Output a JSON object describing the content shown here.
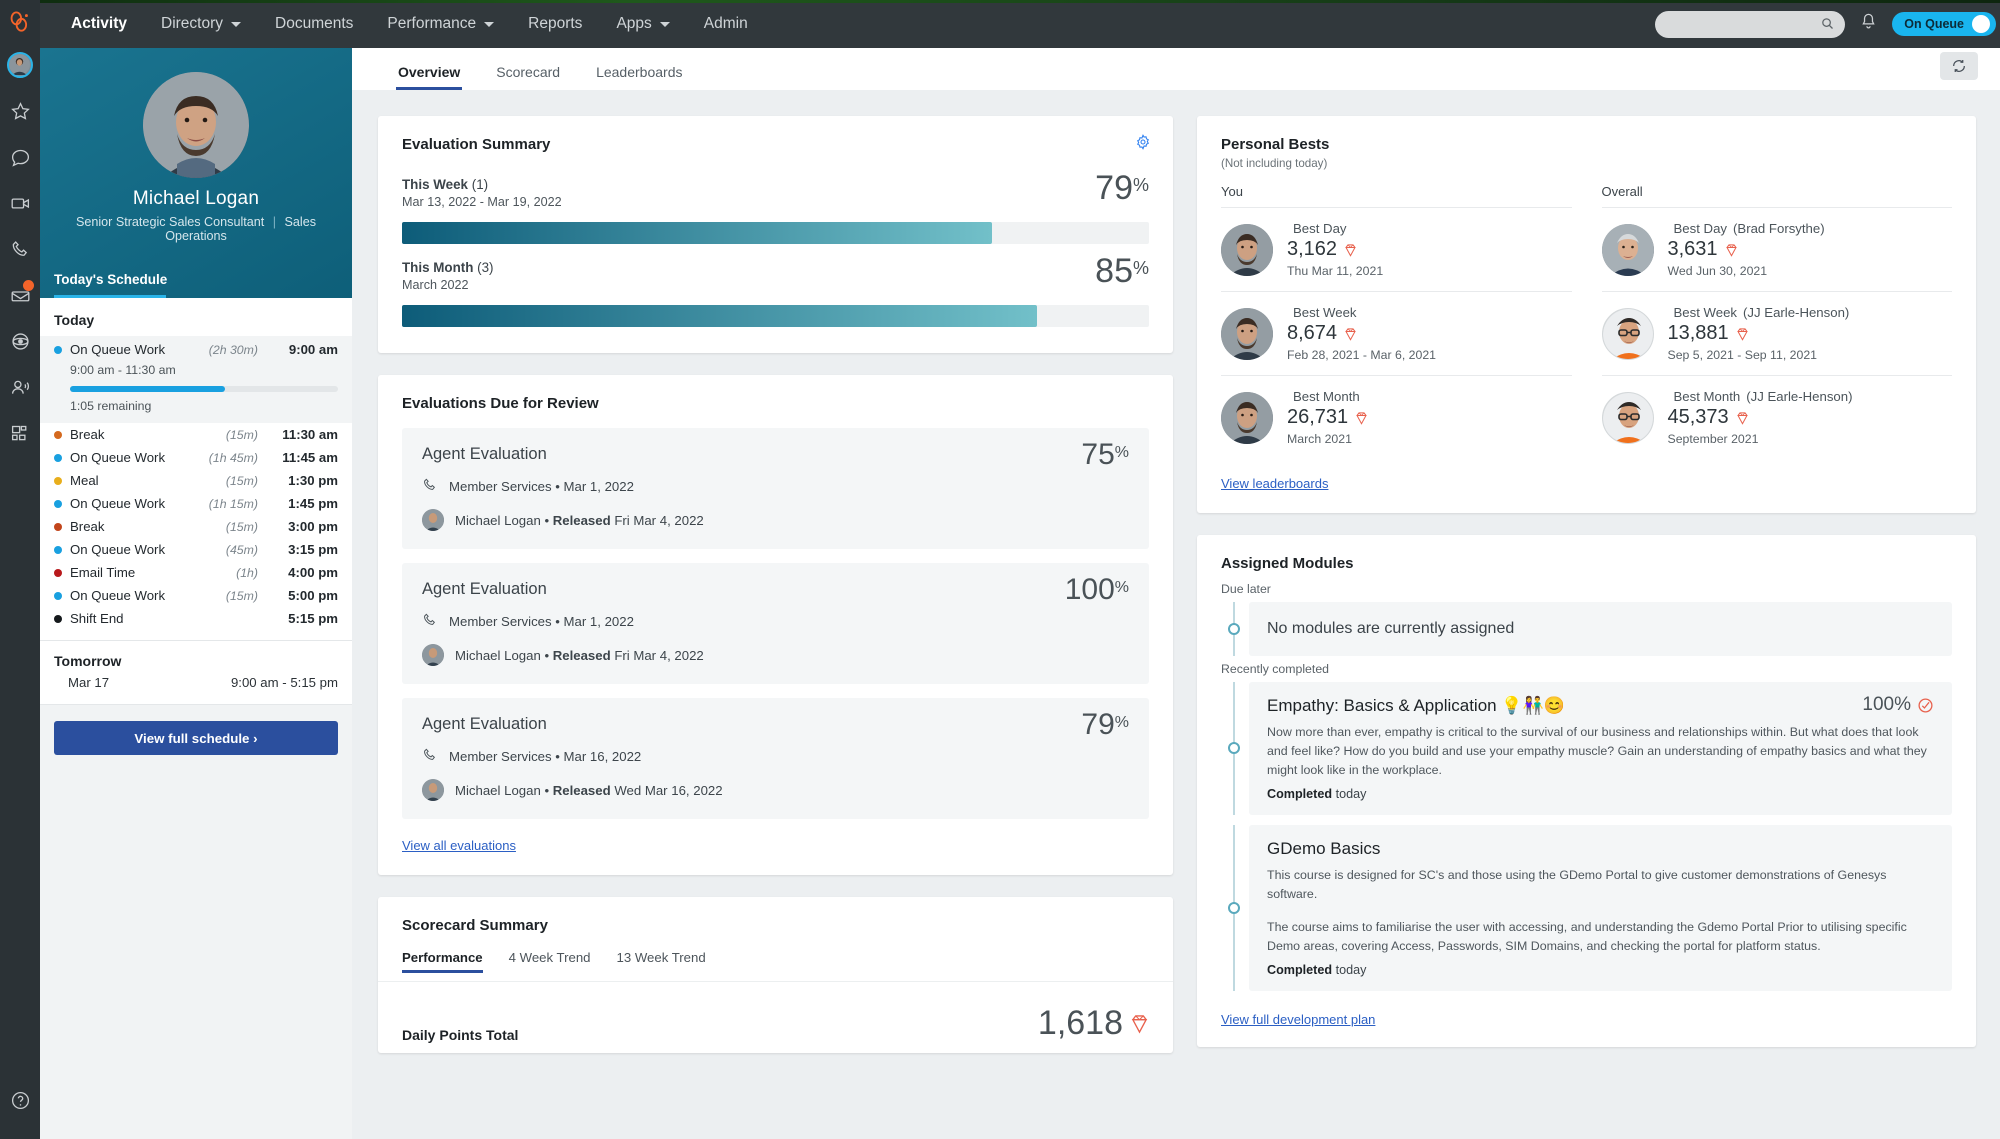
{
  "app": {
    "brand": "genesys-logo",
    "status_label": "On Queue"
  },
  "topnav": {
    "items": [
      {
        "label": "Activity",
        "active": true,
        "caret": false
      },
      {
        "label": "Directory",
        "active": false,
        "caret": true
      },
      {
        "label": "Documents",
        "active": false,
        "caret": false
      },
      {
        "label": "Performance",
        "active": false,
        "caret": true
      },
      {
        "label": "Reports",
        "active": false,
        "caret": false
      },
      {
        "label": "Apps",
        "active": false,
        "caret": true
      },
      {
        "label": "Admin",
        "active": false,
        "caret": false
      }
    ],
    "search_placeholder": "",
    "search_value": ""
  },
  "rail": {
    "items": [
      {
        "name": "profile-avatar"
      },
      {
        "name": "star-icon"
      },
      {
        "name": "chat-icon"
      },
      {
        "name": "video-icon"
      },
      {
        "name": "phone-icon"
      },
      {
        "name": "voicemail-icon",
        "badge": true
      },
      {
        "name": "interactions-icon"
      },
      {
        "name": "agent-assist-icon"
      },
      {
        "name": "apps-grid-icon"
      },
      {
        "name": "help-icon"
      }
    ]
  },
  "profile": {
    "name": "Michael Logan",
    "title": "Senior Strategic Sales Consultant",
    "department": "Sales Operations",
    "schedule_tab": "Today's Schedule"
  },
  "schedule": {
    "today_label": "Today",
    "active": {
      "label": "On Queue Work",
      "duration": "(2h 30m)",
      "time": "9:00 am",
      "range": "9:00 am - 11:30 am",
      "progress_pct": 58,
      "remaining": "1:05 remaining",
      "color": "#19a0e0"
    },
    "rows": [
      {
        "label": "Break",
        "duration": "(15m)",
        "time": "11:30 am",
        "color": "#d4691e"
      },
      {
        "label": "On Queue Work",
        "duration": "(1h 45m)",
        "time": "11:45 am",
        "color": "#19a0e0"
      },
      {
        "label": "Meal",
        "duration": "(15m)",
        "time": "1:30 pm",
        "color": "#e8ae1c"
      },
      {
        "label": "On Queue Work",
        "duration": "(1h 15m)",
        "time": "1:45 pm",
        "color": "#19a0e0"
      },
      {
        "label": "Break",
        "duration": "(15m)",
        "time": "3:00 pm",
        "color": "#c2451b"
      },
      {
        "label": "On Queue Work",
        "duration": "(45m)",
        "time": "3:15 pm",
        "color": "#19a0e0"
      },
      {
        "label": "Email Time",
        "duration": "(1h)",
        "time": "4:00 pm",
        "color": "#b8191c"
      },
      {
        "label": "On Queue Work",
        "duration": "(15m)",
        "time": "5:00 pm",
        "color": "#19a0e0"
      },
      {
        "label": "Shift End",
        "duration": "",
        "time": "5:15 pm",
        "color": "#15191c"
      }
    ],
    "tomorrow_label": "Tomorrow",
    "tomorrow_date": "Mar 17",
    "tomorrow_range": "9:00 am - 5:15 pm",
    "button": "View full schedule ›"
  },
  "content_tabs": [
    {
      "label": "Overview",
      "active": true
    },
    {
      "label": "Scorecard",
      "active": false
    },
    {
      "label": "Leaderboards",
      "active": false
    }
  ],
  "evaluation_summary": {
    "title": "Evaluation Summary",
    "blocks": [
      {
        "label": "This Week",
        "count": "(1)",
        "sub": "Mar 13, 2022 - Mar 19, 2022",
        "pct": "79",
        "fill": 79
      },
      {
        "label": "This Month",
        "count": "(3)",
        "sub": "March 2022",
        "pct": "85",
        "fill": 85
      }
    ]
  },
  "evaluations_due": {
    "title": "Evaluations Due for Review",
    "items": [
      {
        "name": "Agent Evaluation",
        "pct": "75",
        "queue": "Member Services • Mar 1, 2022",
        "evaluator": "Michael Logan • ",
        "status": "Released",
        "released": " Fri Mar 4, 2022"
      },
      {
        "name": "Agent Evaluation",
        "pct": "100",
        "queue": "Member Services • Mar 1, 2022",
        "evaluator": "Michael Logan • ",
        "status": "Released",
        "released": " Fri Mar 4, 2022"
      },
      {
        "name": "Agent Evaluation",
        "pct": "79",
        "queue": "Member Services • Mar 16, 2022",
        "evaluator": "Michael Logan • ",
        "status": "Released",
        "released": " Wed Mar 16, 2022"
      }
    ],
    "view_all": "View all evaluations"
  },
  "scorecard_summary": {
    "title": "Scorecard Summary",
    "tabs": [
      {
        "label": "Performance",
        "active": true
      },
      {
        "label": "4 Week Trend",
        "active": false
      },
      {
        "label": "13 Week Trend",
        "active": false
      }
    ],
    "total_label": "Daily Points Total",
    "total_value": "1,618"
  },
  "personal_bests": {
    "title": "Personal Bests",
    "subtitle": "(Not including today)",
    "you_label": "You",
    "overall_label": "Overall",
    "you": [
      {
        "label": "Best Day",
        "owner": "",
        "value": "3,162",
        "date": "Thu Mar 11, 2021"
      },
      {
        "label": "Best Week",
        "owner": "",
        "value": "8,674",
        "date": "Feb 28, 2021 - Mar 6, 2021"
      },
      {
        "label": "Best Month",
        "owner": "",
        "value": "26,731",
        "date": "March 2021"
      }
    ],
    "overall": [
      {
        "label": "Best Day",
        "owner": "(Brad Forsythe)",
        "value": "3,631",
        "date": "Wed Jun 30, 2021"
      },
      {
        "label": "Best Week",
        "owner": "(JJ Earle-Henson)",
        "value": "13,881",
        "date": "Sep 5, 2021 - Sep 11, 2021"
      },
      {
        "label": "Best Month",
        "owner": "(JJ Earle-Henson)",
        "value": "45,373",
        "date": "September 2021"
      }
    ],
    "view_leaderboards": "View leaderboards"
  },
  "assigned_modules": {
    "title": "Assigned Modules",
    "due_later_label": "Due later",
    "due_later_empty": "No modules are currently assigned",
    "recently_completed_label": "Recently completed",
    "modules": [
      {
        "title": "Empathy: Basics & Application 💡👫😊",
        "pct": "100%",
        "desc": "Now more than ever, empathy is critical to the survival of our business and relationships within. But what does that look and feel like? How do you build and use your empathy muscle? Gain an understanding of empathy basics and what they might look like in the workplace.",
        "status_bold": "Completed",
        "status_rest": " today"
      },
      {
        "title": "GDemo Basics",
        "pct": "",
        "desc": "This course is designed for SC's and those using the GDemo Portal to give customer demonstrations of Genesys software.",
        "desc2": "The course aims to familiarise the user with accessing, and understanding the Gdemo Portal Prior to utilising specific Demo areas, covering Access, Passwords, SIM Domains, and checking the portal for platform status.",
        "status_bold": "Completed",
        "status_rest": " today"
      }
    ],
    "view_plan": "View full development plan"
  },
  "colors": {
    "accent_blue": "#2b4f9e",
    "teal": "#136880",
    "status_cyan": "#19b5ef",
    "gem_red": "#e8604c"
  }
}
